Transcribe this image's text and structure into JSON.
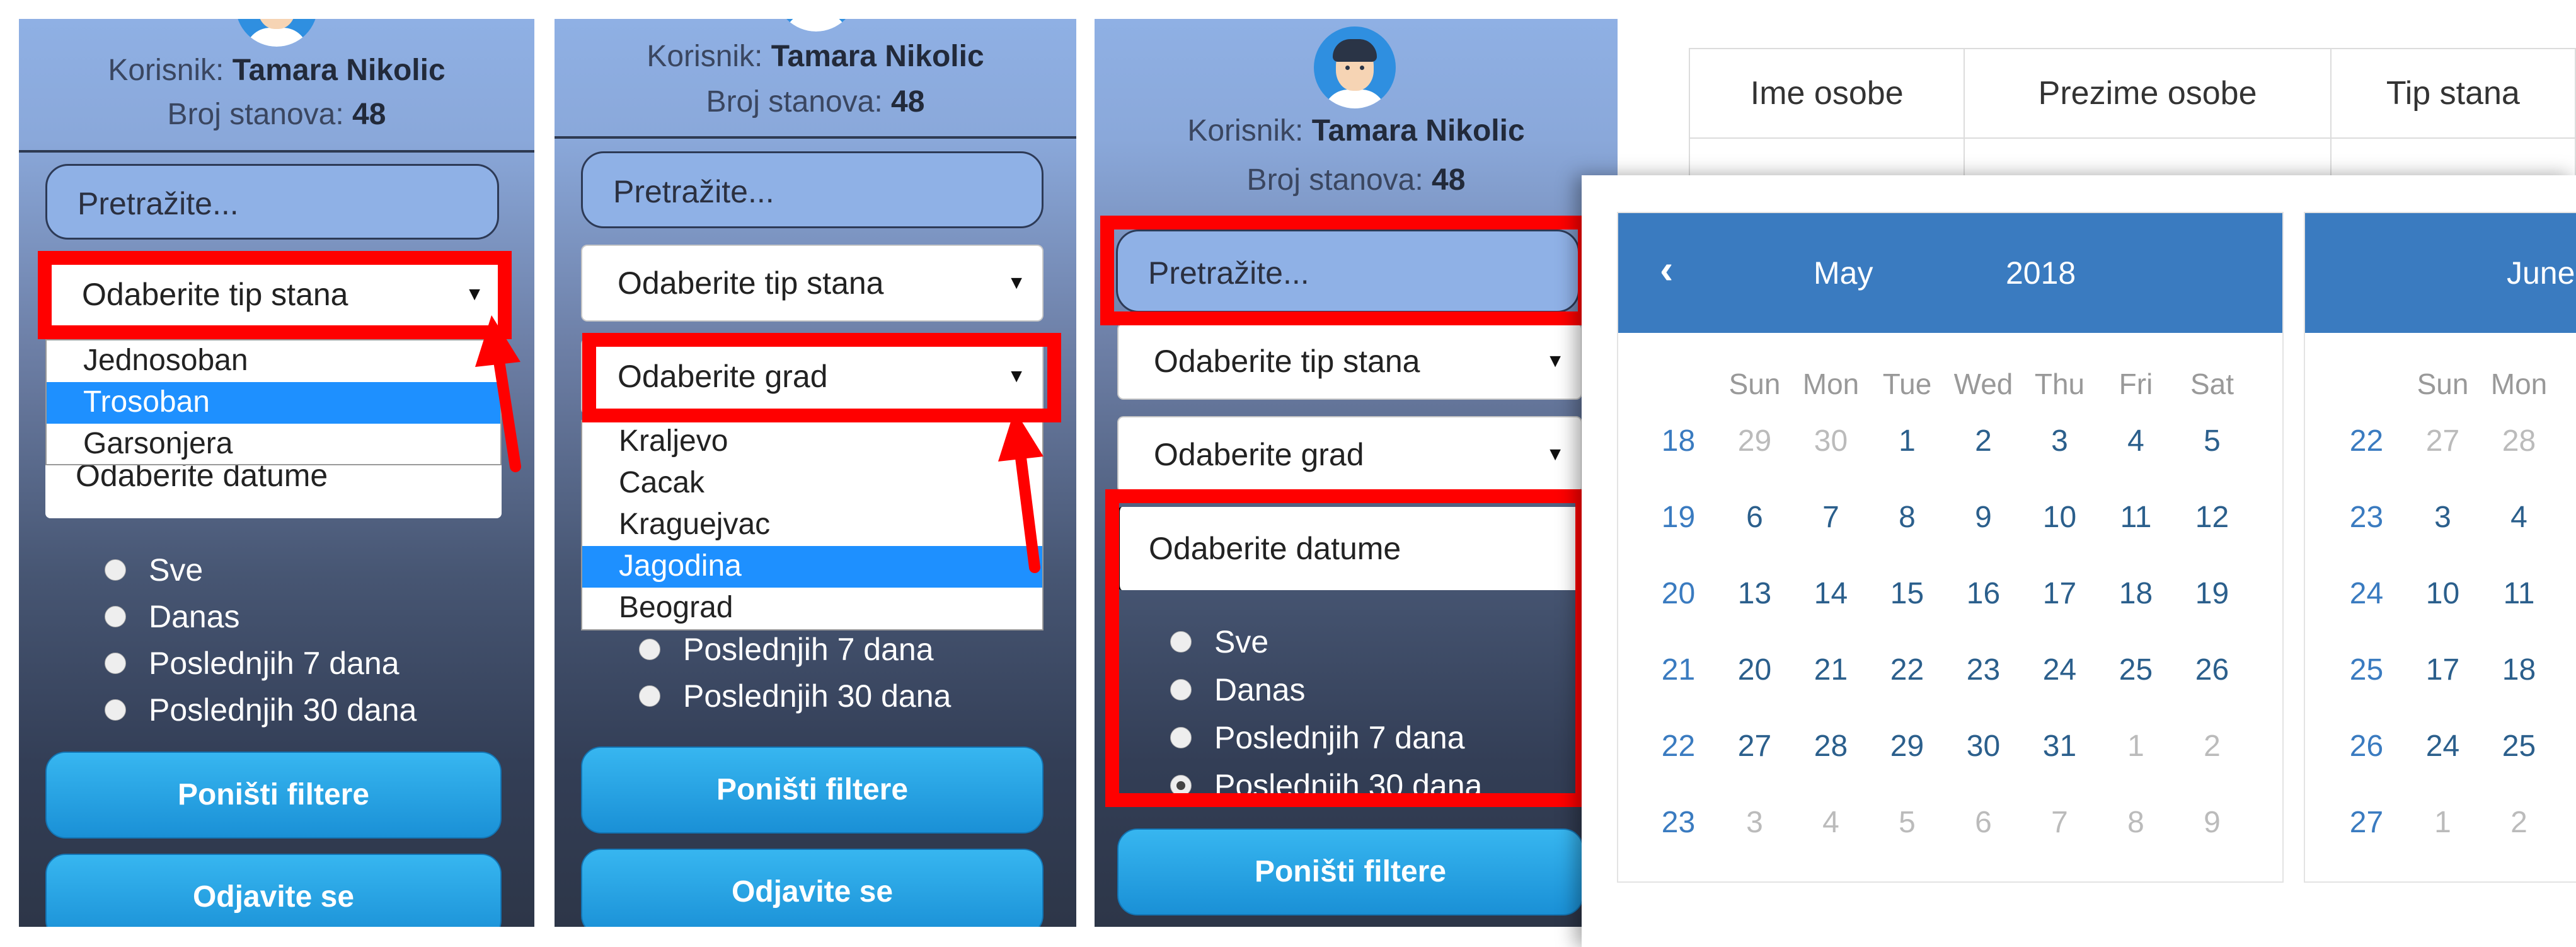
{
  "user": {
    "label": "Korisnik:",
    "name": "Tamara Nikolic",
    "count_label": "Broj stanova:",
    "count": "48"
  },
  "search": {
    "placeholder": "Pretražite..."
  },
  "filters": {
    "type_placeholder": "Odaberite tip stana",
    "city_placeholder": "Odaberite grad",
    "date_placeholder": "Odaberite datume"
  },
  "type_options": [
    "Jednosoban",
    "Trosoban",
    "Garsonjera"
  ],
  "type_selected": "Trosoban",
  "city_options": [
    "Kraljevo",
    "Cacak",
    "Kraguejvac",
    "Jagodina",
    "Beograd"
  ],
  "city_selected": "Jagodina",
  "date_options": [
    "Sve",
    "Danas",
    "Poslednjih 7 dana",
    "Poslednjih 30 dana"
  ],
  "date_selected": "Poslednjih 30 dana",
  "buttons": {
    "reset": "Poništi filtere",
    "logout": "Odjavite se"
  },
  "table_headers": [
    "Ime osobe",
    "Prezime osobe",
    "Tip stana"
  ],
  "calendar": {
    "prev_icon": "chevron-left",
    "left": {
      "month": "May",
      "year": "2018"
    },
    "right": {
      "month": "June"
    },
    "dow": [
      "Sun",
      "Mon",
      "Tue",
      "Wed",
      "Thu",
      "Fri",
      "Sat"
    ],
    "left_weeks": [
      "18",
      "19",
      "20",
      "21",
      "22",
      "23"
    ],
    "left_days": [
      [
        "29",
        "30",
        "1",
        "2",
        "3",
        "4",
        "5"
      ],
      [
        "6",
        "7",
        "8",
        "9",
        "10",
        "11",
        "12"
      ],
      [
        "13",
        "14",
        "15",
        "16",
        "17",
        "18",
        "19"
      ],
      [
        "20",
        "21",
        "22",
        "23",
        "24",
        "25",
        "26"
      ],
      [
        "27",
        "28",
        "29",
        "30",
        "31",
        "1",
        "2"
      ],
      [
        "3",
        "4",
        "5",
        "6",
        "7",
        "8",
        "9"
      ]
    ],
    "right_weeks": [
      "22",
      "23",
      "24",
      "25",
      "26",
      "27"
    ],
    "right_days": [
      [
        "27",
        "28"
      ],
      [
        "3",
        "4"
      ],
      [
        "10",
        "11"
      ],
      [
        "17",
        "18"
      ],
      [
        "24",
        "25"
      ],
      [
        "1",
        "2"
      ]
    ]
  },
  "colors": {
    "highlight": "#ff0000",
    "accent": "#3a7bc0",
    "button": "#1a90d6",
    "selected_option": "#1e90ff"
  }
}
